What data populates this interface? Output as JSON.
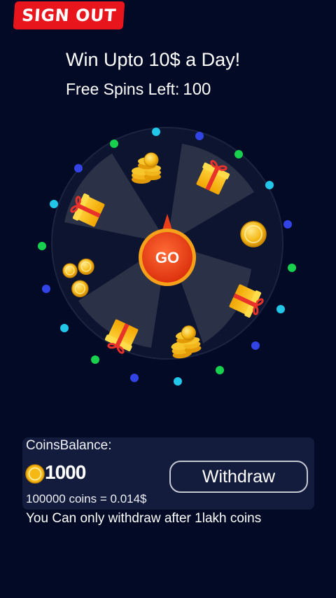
{
  "header": {
    "signout_label": "SIGN OUT",
    "headline": "Win Upto 10$ a Day!",
    "free_spins_label": "Free Spins Left:",
    "free_spins_value": "100"
  },
  "wheel": {
    "go_label": "GO",
    "segments": [
      "coin-stack",
      "gift",
      "coin",
      "gift",
      "coin-stack",
      "gift",
      "coins",
      "gift"
    ],
    "colors": {
      "segment_dark": "#0c1430",
      "segment_light": "#2b3147",
      "go_orange": "#ee3f18",
      "go_ring": "#f7a11a",
      "dot_cyan": "#22c6e8",
      "dot_blue": "#3344e6",
      "dot_green": "#17d04e"
    }
  },
  "wallet": {
    "balance_label": "CoinsBalance:",
    "balance_value": "1000",
    "withdraw_label": "Withdraw",
    "rate_text": "100000 coins = 0.014$",
    "note_text": "You Can only withdraw after 1lakh coins"
  }
}
